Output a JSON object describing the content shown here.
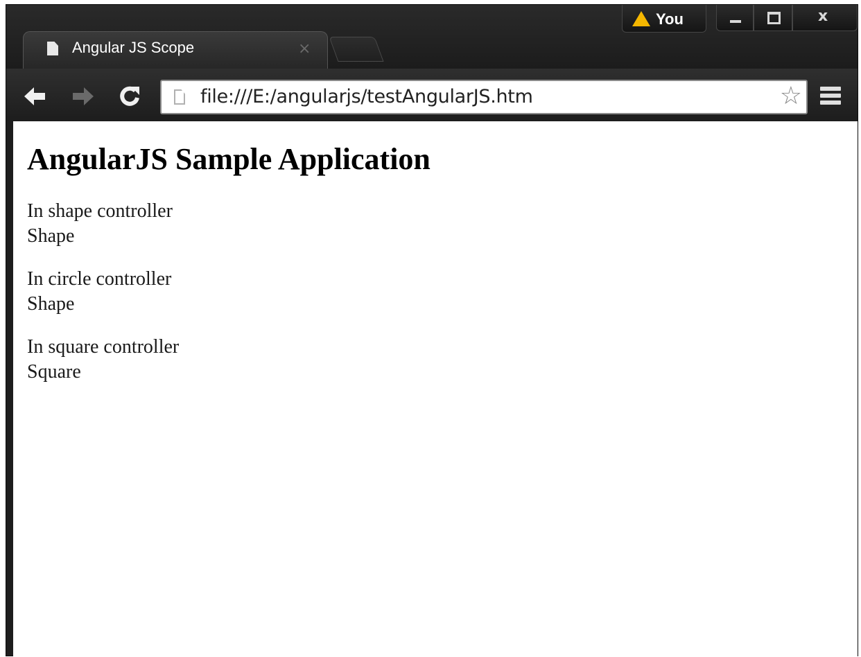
{
  "browser": {
    "tab": {
      "title": "Angular JS Scope"
    },
    "profile": {
      "name": "You"
    },
    "address_bar": {
      "url": "file:///E:/angularjs/testAngularJS.htm"
    }
  },
  "page": {
    "heading": "AngularJS Sample Application",
    "sections": [
      {
        "line1": "In shape controller",
        "line2": "Shape"
      },
      {
        "line1": "In circle controller",
        "line2": "Shape"
      },
      {
        "line1": "In square controller",
        "line2": "Square"
      }
    ]
  },
  "icons": {
    "tab": "page-icon",
    "profile": "warning-icon",
    "back": "arrow-left-icon",
    "forward": "arrow-right-icon",
    "reload": "reload-icon",
    "bookmark": "star-icon",
    "menu": "hamburger-menu-icon"
  },
  "colors": {
    "window_chrome": "#1e1e1e",
    "warning": "#f5b700",
    "page_background": "#ffffff",
    "text": "#000000"
  }
}
